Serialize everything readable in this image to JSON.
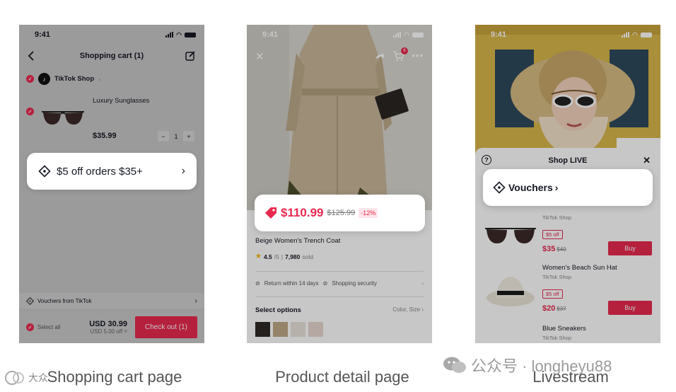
{
  "colors": {
    "accent": "#e8294f",
    "dim_overlay": "rgba(0,0,0,0.22)"
  },
  "cart": {
    "time": "9:41",
    "title": "Shopping cart (1)",
    "shop_name": "TikTok Shop",
    "item_name": "Luxury Sunglasses",
    "item_price": "$35.99",
    "qty_minus": "−",
    "qty": "1",
    "qty_plus": "+",
    "card_text": "$5 off orders $35+",
    "vouchers_label": "Vouchers from TikTok",
    "select_all": "Select all",
    "total": "USD 30.99",
    "discount": "USD 5.00 off",
    "checkout": "Check out (1)",
    "icons": [
      "back-arrow-icon",
      "edit-icon",
      "check-icon",
      "tiktok-logo-icon",
      "ticket-icon",
      "chevron-right-icon"
    ]
  },
  "detail": {
    "time": "9:41",
    "cart_count": "6",
    "price": "$110.99",
    "old_price": "$125.99",
    "discount": "-12%",
    "product_name": "Beige Women's Trench Coat",
    "rating": "4.5",
    "rating_scale": "/5",
    "sold_count": "7,980",
    "sold_label": "sold",
    "return_policy": "Return within 14 days",
    "security": "Shopping security",
    "select_options": "Select options",
    "option_types": "Color, Size",
    "icons": [
      "close-icon",
      "share-icon",
      "cart-icon",
      "more-icon",
      "price-tag-icon",
      "star-icon",
      "shield-check-icon"
    ]
  },
  "live": {
    "time": "9:41",
    "panel_title": "Shop LIVE",
    "help_glyph": "?",
    "close_glyph": "✕",
    "card_text": "Vouchers",
    "products": [
      {
        "shop": "TikTok Shop",
        "coupon": "$5 off",
        "price": "$35",
        "old_price": "$40",
        "buy": "Buy"
      },
      {
        "name": "Women's Beach Sun Hat",
        "shop": "TikTok Shop",
        "coupon": "$5 off",
        "price": "$20",
        "old_price": "$37",
        "buy": "Buy"
      },
      {
        "name": "Blue Sneakers",
        "shop": "TikTok Shop"
      }
    ],
    "icons": [
      "help-icon",
      "close-icon",
      "ticket-icon",
      "chevron-right-icon"
    ]
  },
  "captions": [
    "Shopping cart page",
    "Product detail page",
    "Livestream"
  ],
  "watermark": {
    "text": "公众号 · longheyu88",
    "left_text": "大众.."
  }
}
